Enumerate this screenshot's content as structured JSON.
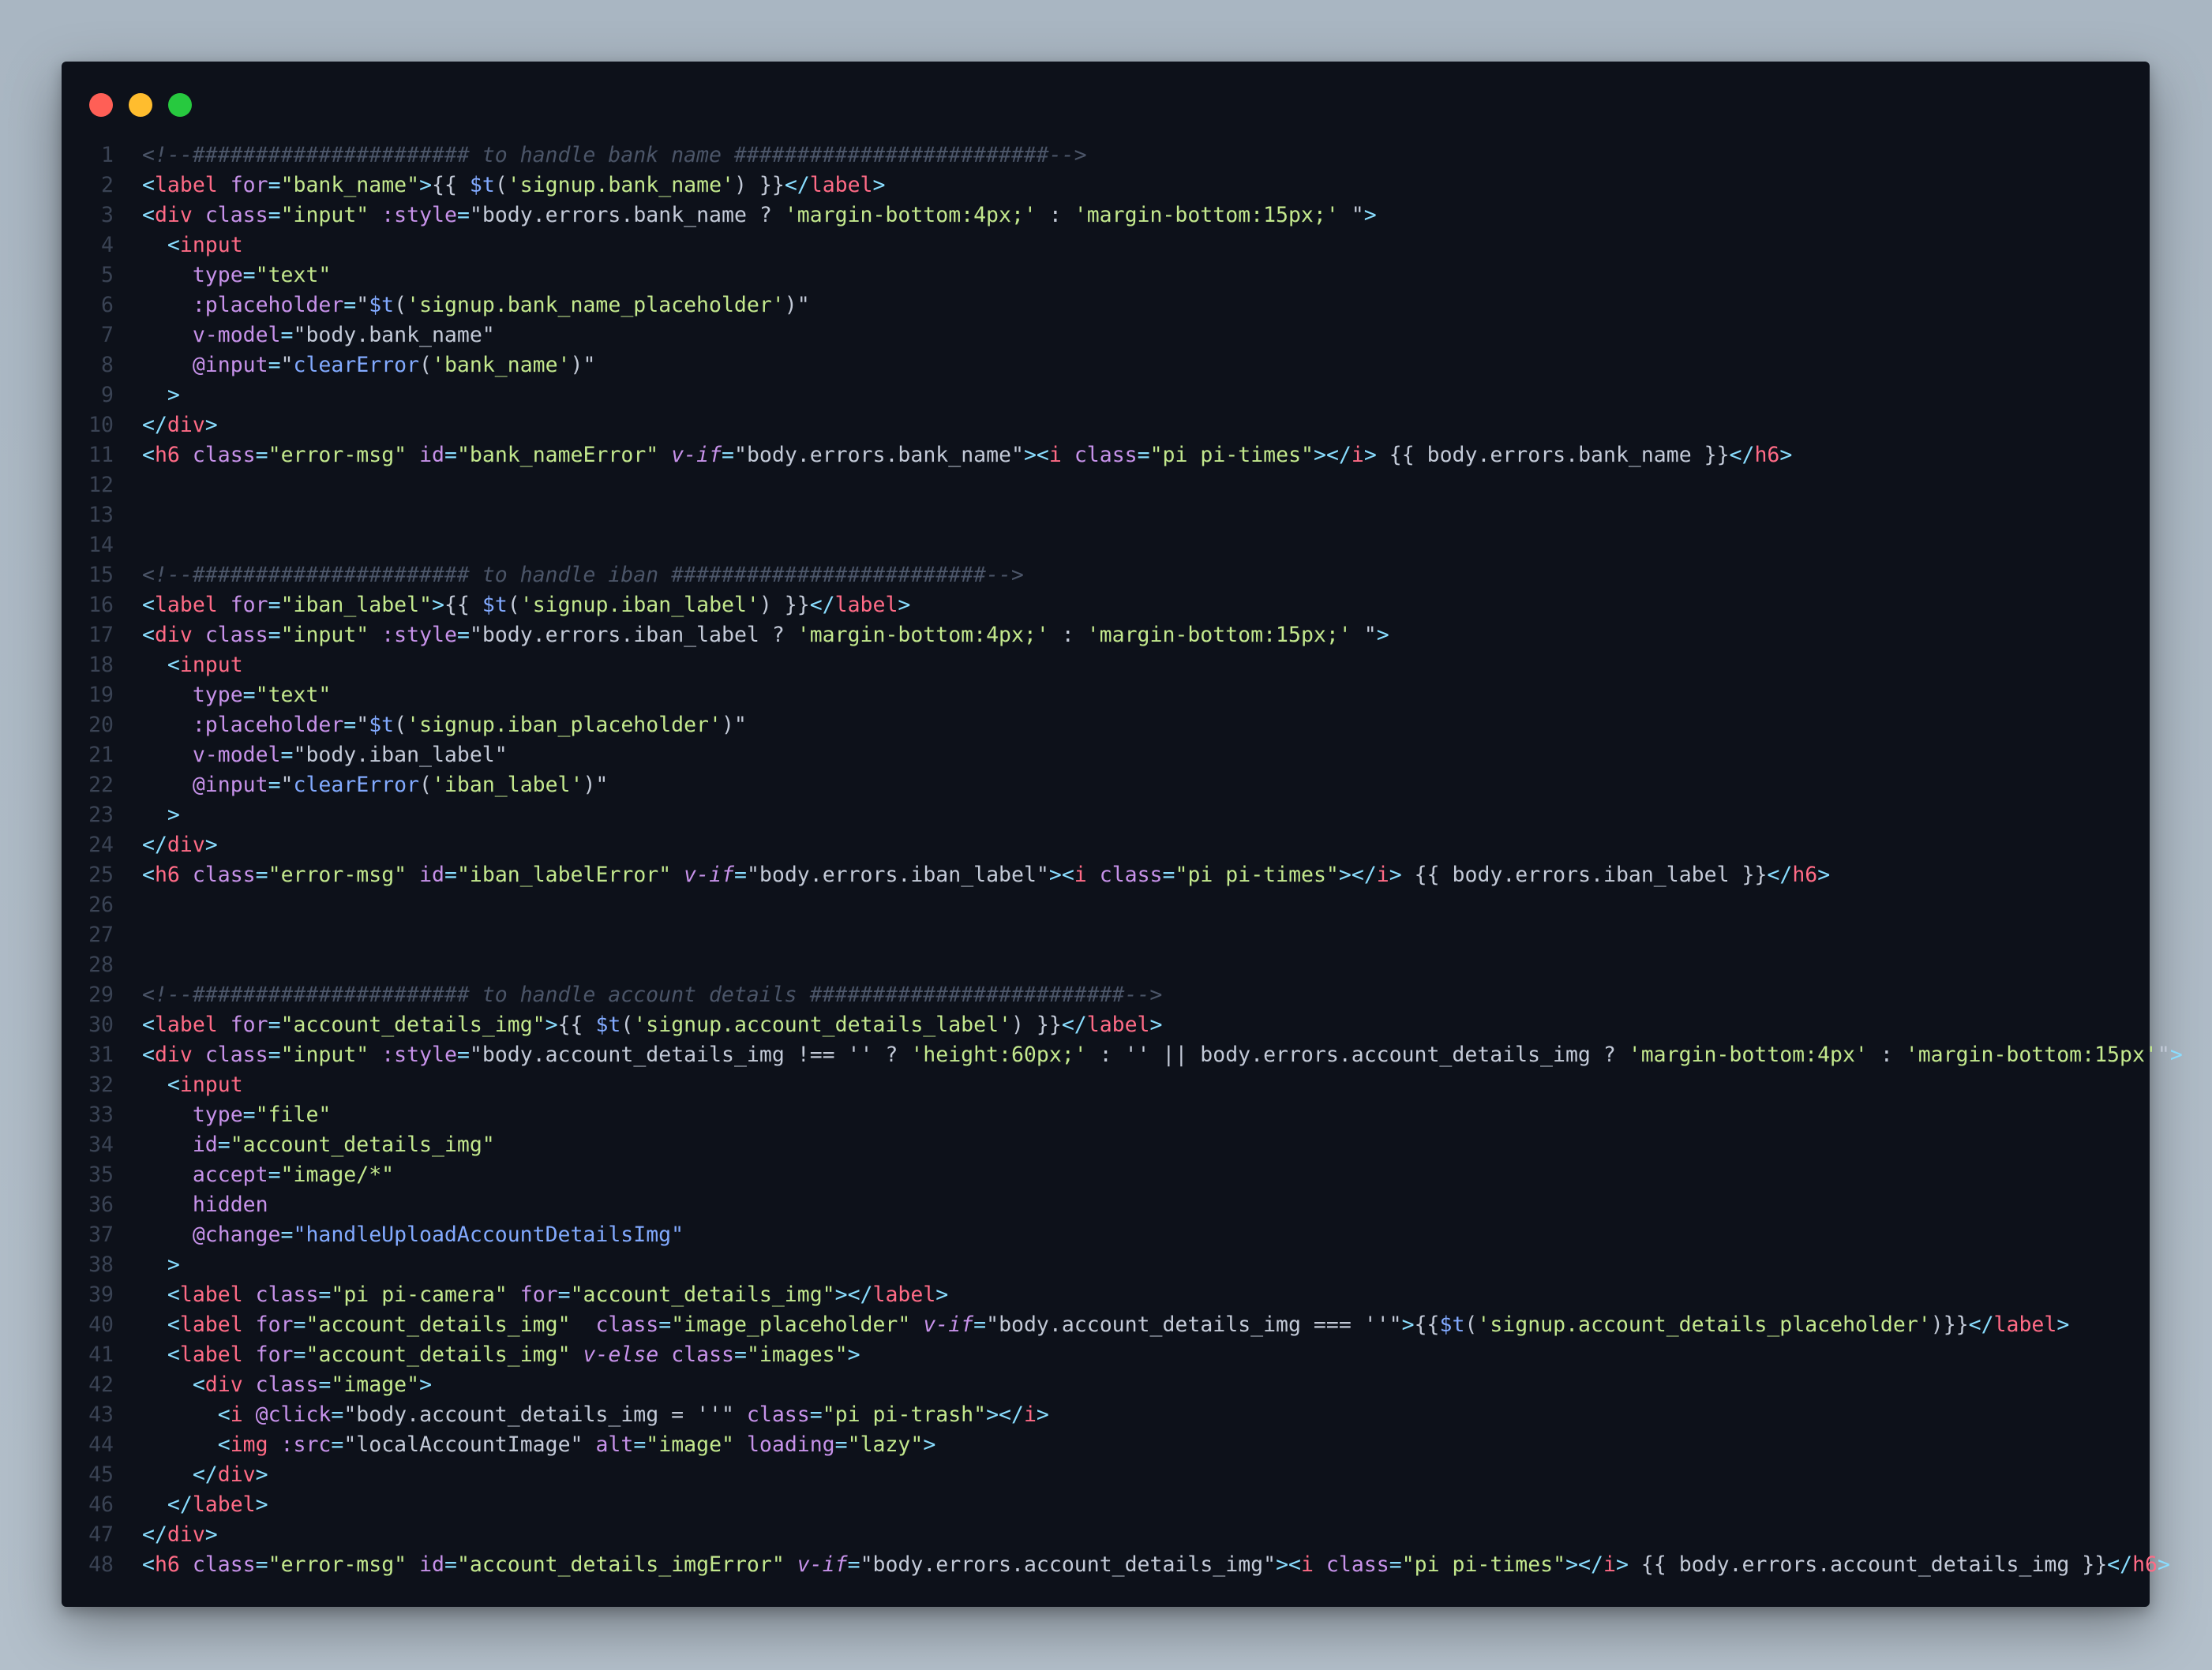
{
  "window": {
    "controls": [
      "close",
      "minimize",
      "maximize"
    ],
    "colors": {
      "close": "#ff5f56",
      "minimize": "#ffbd2e",
      "maximize": "#27c93f"
    }
  },
  "lines": [
    [
      [
        "com",
        "<!--###################### to handle bank name #########################-->"
      ]
    ],
    [
      [
        "punc",
        "<"
      ],
      [
        "tag",
        "label"
      ],
      [
        "txt",
        " "
      ],
      [
        "attr",
        "for"
      ],
      [
        "punc",
        "="
      ],
      [
        "str",
        "\"bank_name\""
      ],
      [
        "punc",
        ">"
      ],
      [
        "txt",
        "{{ "
      ],
      [
        "fn",
        "$t"
      ],
      [
        "txt",
        "("
      ],
      [
        "str",
        "'signup.bank_name'"
      ],
      [
        "txt",
        ") }}"
      ],
      [
        "punc",
        "</"
      ],
      [
        "tag",
        "label"
      ],
      [
        "punc",
        ">"
      ]
    ],
    [
      [
        "punc",
        "<"
      ],
      [
        "tag",
        "div"
      ],
      [
        "txt",
        " "
      ],
      [
        "attr",
        "class"
      ],
      [
        "punc",
        "="
      ],
      [
        "str",
        "\"input\""
      ],
      [
        "txt",
        " "
      ],
      [
        "attr",
        ":style"
      ],
      [
        "punc",
        "="
      ],
      [
        "txt",
        "\"body.errors.bank_name ? "
      ],
      [
        "str",
        "'margin-bottom:4px;'"
      ],
      [
        "txt",
        " : "
      ],
      [
        "str",
        "'margin-bottom:15px;'"
      ],
      [
        "txt",
        " \""
      ],
      [
        "punc",
        ">"
      ]
    ],
    [
      [
        "txt",
        "  "
      ],
      [
        "punc",
        "<"
      ],
      [
        "tag",
        "input"
      ]
    ],
    [
      [
        "txt",
        "    "
      ],
      [
        "attr",
        "type"
      ],
      [
        "punc",
        "="
      ],
      [
        "str",
        "\"text\""
      ]
    ],
    [
      [
        "txt",
        "    "
      ],
      [
        "attr",
        ":placeholder"
      ],
      [
        "punc",
        "="
      ],
      [
        "txt",
        "\""
      ],
      [
        "fn",
        "$t"
      ],
      [
        "txt",
        "("
      ],
      [
        "str",
        "'signup.bank_name_placeholder'"
      ],
      [
        "txt",
        ")\""
      ]
    ],
    [
      [
        "txt",
        "    "
      ],
      [
        "attr",
        "v-model"
      ],
      [
        "punc",
        "="
      ],
      [
        "txt",
        "\"body.bank_name\""
      ]
    ],
    [
      [
        "txt",
        "    "
      ],
      [
        "attr",
        "@input"
      ],
      [
        "punc",
        "="
      ],
      [
        "txt",
        "\""
      ],
      [
        "fn",
        "clearError"
      ],
      [
        "txt",
        "("
      ],
      [
        "str",
        "'bank_name'"
      ],
      [
        "txt",
        ")\""
      ]
    ],
    [
      [
        "txt",
        "  "
      ],
      [
        "punc",
        ">"
      ]
    ],
    [
      [
        "punc",
        "</"
      ],
      [
        "tag",
        "div"
      ],
      [
        "punc",
        ">"
      ]
    ],
    [
      [
        "punc",
        "<"
      ],
      [
        "tag",
        "h6"
      ],
      [
        "txt",
        " "
      ],
      [
        "attr",
        "class"
      ],
      [
        "punc",
        "="
      ],
      [
        "str",
        "\"error-msg\""
      ],
      [
        "txt",
        " "
      ],
      [
        "attr",
        "id"
      ],
      [
        "punc",
        "="
      ],
      [
        "str",
        "\"bank_nameError\""
      ],
      [
        "txt",
        " "
      ],
      [
        "attri",
        "v-if"
      ],
      [
        "punc",
        "="
      ],
      [
        "txt",
        "\"body.errors.bank_name\""
      ],
      [
        "punc",
        "><"
      ],
      [
        "tag",
        "i"
      ],
      [
        "txt",
        " "
      ],
      [
        "attr",
        "class"
      ],
      [
        "punc",
        "="
      ],
      [
        "str",
        "\"pi pi-times\""
      ],
      [
        "punc",
        "></"
      ],
      [
        "tag",
        "i"
      ],
      [
        "punc",
        ">"
      ],
      [
        "txt",
        " {{ body.errors.bank_name }}"
      ],
      [
        "punc",
        "</"
      ],
      [
        "tag",
        "h6"
      ],
      [
        "punc",
        ">"
      ]
    ],
    [],
    [],
    [],
    [
      [
        "com",
        "<!--###################### to handle iban #########################-->"
      ]
    ],
    [
      [
        "punc",
        "<"
      ],
      [
        "tag",
        "label"
      ],
      [
        "txt",
        " "
      ],
      [
        "attr",
        "for"
      ],
      [
        "punc",
        "="
      ],
      [
        "str",
        "\"iban_label\""
      ],
      [
        "punc",
        ">"
      ],
      [
        "txt",
        "{{ "
      ],
      [
        "fn",
        "$t"
      ],
      [
        "txt",
        "("
      ],
      [
        "str",
        "'signup.iban_label'"
      ],
      [
        "txt",
        ") }}"
      ],
      [
        "punc",
        "</"
      ],
      [
        "tag",
        "label"
      ],
      [
        "punc",
        ">"
      ]
    ],
    [
      [
        "punc",
        "<"
      ],
      [
        "tag",
        "div"
      ],
      [
        "txt",
        " "
      ],
      [
        "attr",
        "class"
      ],
      [
        "punc",
        "="
      ],
      [
        "str",
        "\"input\""
      ],
      [
        "txt",
        " "
      ],
      [
        "attr",
        ":style"
      ],
      [
        "punc",
        "="
      ],
      [
        "txt",
        "\"body.errors.iban_label ? "
      ],
      [
        "str",
        "'margin-bottom:4px;'"
      ],
      [
        "txt",
        " : "
      ],
      [
        "str",
        "'margin-bottom:15px;'"
      ],
      [
        "txt",
        " \""
      ],
      [
        "punc",
        ">"
      ]
    ],
    [
      [
        "txt",
        "  "
      ],
      [
        "punc",
        "<"
      ],
      [
        "tag",
        "input"
      ]
    ],
    [
      [
        "txt",
        "    "
      ],
      [
        "attr",
        "type"
      ],
      [
        "punc",
        "="
      ],
      [
        "str",
        "\"text\""
      ]
    ],
    [
      [
        "txt",
        "    "
      ],
      [
        "attr",
        ":placeholder"
      ],
      [
        "punc",
        "="
      ],
      [
        "txt",
        "\""
      ],
      [
        "fn",
        "$t"
      ],
      [
        "txt",
        "("
      ],
      [
        "str",
        "'signup.iban_placeholder'"
      ],
      [
        "txt",
        ")\""
      ]
    ],
    [
      [
        "txt",
        "    "
      ],
      [
        "attr",
        "v-model"
      ],
      [
        "punc",
        "="
      ],
      [
        "txt",
        "\"body.iban_label\""
      ]
    ],
    [
      [
        "txt",
        "    "
      ],
      [
        "attr",
        "@input"
      ],
      [
        "punc",
        "="
      ],
      [
        "txt",
        "\""
      ],
      [
        "fn",
        "clearError"
      ],
      [
        "txt",
        "("
      ],
      [
        "str",
        "'iban_label'"
      ],
      [
        "txt",
        ")\""
      ]
    ],
    [
      [
        "txt",
        "  "
      ],
      [
        "punc",
        ">"
      ]
    ],
    [
      [
        "punc",
        "</"
      ],
      [
        "tag",
        "div"
      ],
      [
        "punc",
        ">"
      ]
    ],
    [
      [
        "punc",
        "<"
      ],
      [
        "tag",
        "h6"
      ],
      [
        "txt",
        " "
      ],
      [
        "attr",
        "class"
      ],
      [
        "punc",
        "="
      ],
      [
        "str",
        "\"error-msg\""
      ],
      [
        "txt",
        " "
      ],
      [
        "attr",
        "id"
      ],
      [
        "punc",
        "="
      ],
      [
        "str",
        "\"iban_labelError\""
      ],
      [
        "txt",
        " "
      ],
      [
        "attri",
        "v-if"
      ],
      [
        "punc",
        "="
      ],
      [
        "txt",
        "\"body.errors.iban_label\""
      ],
      [
        "punc",
        "><"
      ],
      [
        "tag",
        "i"
      ],
      [
        "txt",
        " "
      ],
      [
        "attr",
        "class"
      ],
      [
        "punc",
        "="
      ],
      [
        "str",
        "\"pi pi-times\""
      ],
      [
        "punc",
        "></"
      ],
      [
        "tag",
        "i"
      ],
      [
        "punc",
        ">"
      ],
      [
        "txt",
        " {{ body.errors.iban_label }}"
      ],
      [
        "punc",
        "</"
      ],
      [
        "tag",
        "h6"
      ],
      [
        "punc",
        ">"
      ]
    ],
    [],
    [],
    [],
    [
      [
        "com",
        "<!--###################### to handle account details #########################-->"
      ]
    ],
    [
      [
        "punc",
        "<"
      ],
      [
        "tag",
        "label"
      ],
      [
        "txt",
        " "
      ],
      [
        "attr",
        "for"
      ],
      [
        "punc",
        "="
      ],
      [
        "str",
        "\"account_details_img\""
      ],
      [
        "punc",
        ">"
      ],
      [
        "txt",
        "{{ "
      ],
      [
        "fn",
        "$t"
      ],
      [
        "txt",
        "("
      ],
      [
        "str",
        "'signup.account_details_label'"
      ],
      [
        "txt",
        ") }}"
      ],
      [
        "punc",
        "</"
      ],
      [
        "tag",
        "label"
      ],
      [
        "punc",
        ">"
      ]
    ],
    [
      [
        "punc",
        "<"
      ],
      [
        "tag",
        "div"
      ],
      [
        "txt",
        " "
      ],
      [
        "attr",
        "class"
      ],
      [
        "punc",
        "="
      ],
      [
        "str",
        "\"input\""
      ],
      [
        "txt",
        " "
      ],
      [
        "attr",
        ":style"
      ],
      [
        "punc",
        "="
      ],
      [
        "txt",
        "\"body.account_details_img !== '' ? "
      ],
      [
        "str",
        "'height:60px;'"
      ],
      [
        "txt",
        " : '' || body.errors.account_details_img ? "
      ],
      [
        "str",
        "'margin-bottom:4px'"
      ],
      [
        "txt",
        " : "
      ],
      [
        "str",
        "'margin-bottom:15px'"
      ],
      [
        "txt",
        "\""
      ],
      [
        "punc",
        ">"
      ]
    ],
    [
      [
        "txt",
        "  "
      ],
      [
        "punc",
        "<"
      ],
      [
        "tag",
        "input"
      ]
    ],
    [
      [
        "txt",
        "    "
      ],
      [
        "attr",
        "type"
      ],
      [
        "punc",
        "="
      ],
      [
        "str",
        "\"file\""
      ]
    ],
    [
      [
        "txt",
        "    "
      ],
      [
        "attr",
        "id"
      ],
      [
        "punc",
        "="
      ],
      [
        "str",
        "\"account_details_img\""
      ]
    ],
    [
      [
        "txt",
        "    "
      ],
      [
        "attr",
        "accept"
      ],
      [
        "punc",
        "="
      ],
      [
        "str",
        "\"image/*\""
      ]
    ],
    [
      [
        "txt",
        "    "
      ],
      [
        "attr",
        "hidden"
      ]
    ],
    [
      [
        "txt",
        "    "
      ],
      [
        "attr",
        "@change"
      ],
      [
        "punc",
        "="
      ],
      [
        "fn",
        "\"handleUploadAccountDetailsImg\""
      ]
    ],
    [
      [
        "txt",
        "  "
      ],
      [
        "punc",
        ">"
      ]
    ],
    [
      [
        "txt",
        "  "
      ],
      [
        "punc",
        "<"
      ],
      [
        "tag",
        "label"
      ],
      [
        "txt",
        " "
      ],
      [
        "attr",
        "class"
      ],
      [
        "punc",
        "="
      ],
      [
        "str",
        "\"pi pi-camera\""
      ],
      [
        "txt",
        " "
      ],
      [
        "attr",
        "for"
      ],
      [
        "punc",
        "="
      ],
      [
        "str",
        "\"account_details_img\""
      ],
      [
        "punc",
        "></"
      ],
      [
        "tag",
        "label"
      ],
      [
        "punc",
        ">"
      ]
    ],
    [
      [
        "txt",
        "  "
      ],
      [
        "punc",
        "<"
      ],
      [
        "tag",
        "label"
      ],
      [
        "txt",
        " "
      ],
      [
        "attr",
        "for"
      ],
      [
        "punc",
        "="
      ],
      [
        "str",
        "\"account_details_img\""
      ],
      [
        "txt",
        "  "
      ],
      [
        "attr",
        "class"
      ],
      [
        "punc",
        "="
      ],
      [
        "str",
        "\"image_placeholder\""
      ],
      [
        "txt",
        " "
      ],
      [
        "attri",
        "v-if"
      ],
      [
        "punc",
        "="
      ],
      [
        "txt",
        "\"body.account_details_img === ''\""
      ],
      [
        "punc",
        ">"
      ],
      [
        "txt",
        "{{"
      ],
      [
        "fn",
        "$t"
      ],
      [
        "txt",
        "("
      ],
      [
        "str",
        "'signup.account_details_placeholder'"
      ],
      [
        "txt",
        ")}}"
      ],
      [
        "punc",
        "</"
      ],
      [
        "tag",
        "label"
      ],
      [
        "punc",
        ">"
      ]
    ],
    [
      [
        "txt",
        "  "
      ],
      [
        "punc",
        "<"
      ],
      [
        "tag",
        "label"
      ],
      [
        "txt",
        " "
      ],
      [
        "attr",
        "for"
      ],
      [
        "punc",
        "="
      ],
      [
        "str",
        "\"account_details_img\""
      ],
      [
        "txt",
        " "
      ],
      [
        "attri",
        "v-else"
      ],
      [
        "txt",
        " "
      ],
      [
        "attr",
        "class"
      ],
      [
        "punc",
        "="
      ],
      [
        "str",
        "\"images\""
      ],
      [
        "punc",
        ">"
      ]
    ],
    [
      [
        "txt",
        "    "
      ],
      [
        "punc",
        "<"
      ],
      [
        "tag",
        "div"
      ],
      [
        "txt",
        " "
      ],
      [
        "attr",
        "class"
      ],
      [
        "punc",
        "="
      ],
      [
        "str",
        "\"image\""
      ],
      [
        "punc",
        ">"
      ]
    ],
    [
      [
        "txt",
        "      "
      ],
      [
        "punc",
        "<"
      ],
      [
        "tag",
        "i"
      ],
      [
        "txt",
        " "
      ],
      [
        "attr",
        "@click"
      ],
      [
        "punc",
        "="
      ],
      [
        "txt",
        "\"body.account_details_img = ''\""
      ],
      [
        "txt",
        " "
      ],
      [
        "attr",
        "class"
      ],
      [
        "punc",
        "="
      ],
      [
        "str",
        "\"pi pi-trash\""
      ],
      [
        "punc",
        "></"
      ],
      [
        "tag",
        "i"
      ],
      [
        "punc",
        ">"
      ]
    ],
    [
      [
        "txt",
        "      "
      ],
      [
        "punc",
        "<"
      ],
      [
        "tag",
        "img"
      ],
      [
        "txt",
        " "
      ],
      [
        "attr",
        ":src"
      ],
      [
        "punc",
        "="
      ],
      [
        "txt",
        "\"localAccountImage\""
      ],
      [
        "txt",
        " "
      ],
      [
        "attr",
        "alt"
      ],
      [
        "punc",
        "="
      ],
      [
        "str",
        "\"image\""
      ],
      [
        "txt",
        " "
      ],
      [
        "attr",
        "loading"
      ],
      [
        "punc",
        "="
      ],
      [
        "str",
        "\"lazy\""
      ],
      [
        "punc",
        ">"
      ]
    ],
    [
      [
        "txt",
        "    "
      ],
      [
        "punc",
        "</"
      ],
      [
        "tag",
        "div"
      ],
      [
        "punc",
        ">"
      ]
    ],
    [
      [
        "txt",
        "  "
      ],
      [
        "punc",
        "</"
      ],
      [
        "tag",
        "label"
      ],
      [
        "punc",
        ">"
      ]
    ],
    [
      [
        "punc",
        "</"
      ],
      [
        "tag",
        "div"
      ],
      [
        "punc",
        ">"
      ]
    ],
    [
      [
        "punc",
        "<"
      ],
      [
        "tag",
        "h6"
      ],
      [
        "txt",
        " "
      ],
      [
        "attr",
        "class"
      ],
      [
        "punc",
        "="
      ],
      [
        "str",
        "\"error-msg\""
      ],
      [
        "txt",
        " "
      ],
      [
        "attr",
        "id"
      ],
      [
        "punc",
        "="
      ],
      [
        "str",
        "\"account_details_imgError\""
      ],
      [
        "txt",
        " "
      ],
      [
        "attri",
        "v-if"
      ],
      [
        "punc",
        "="
      ],
      [
        "txt",
        "\"body.errors.account_details_img\""
      ],
      [
        "punc",
        "><"
      ],
      [
        "tag",
        "i"
      ],
      [
        "txt",
        " "
      ],
      [
        "attr",
        "class"
      ],
      [
        "punc",
        "="
      ],
      [
        "str",
        "\"pi pi-times\""
      ],
      [
        "punc",
        "></"
      ],
      [
        "tag",
        "i"
      ],
      [
        "punc",
        ">"
      ],
      [
        "txt",
        " {{ body.errors.account_details_img }}"
      ],
      [
        "punc",
        "</"
      ],
      [
        "tag",
        "h6"
      ],
      [
        "punc",
        ">"
      ]
    ]
  ]
}
